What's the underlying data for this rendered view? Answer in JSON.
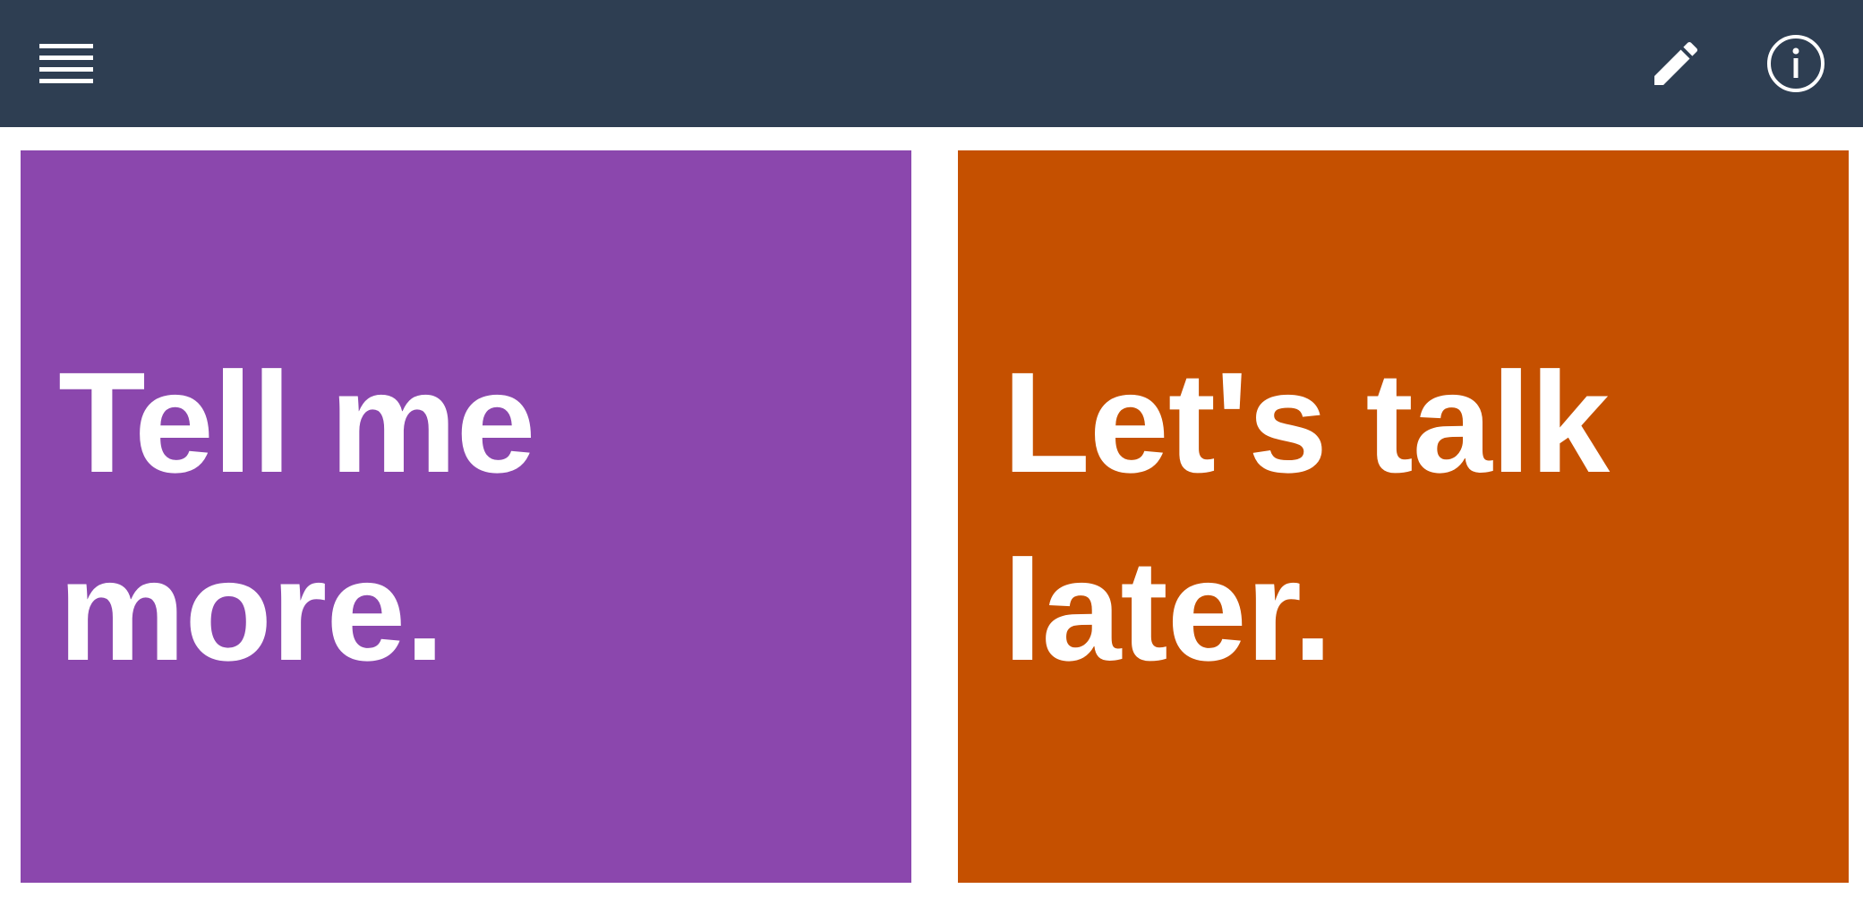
{
  "colors": {
    "topbar_bg": "#2e3e52",
    "icon_color": "#ffffff",
    "tile_text_color": "#ffffff"
  },
  "topbar": {
    "menu_icon": "hamburger-menu-icon",
    "edit_icon": "pencil-icon",
    "info_icon": "info-circle-icon"
  },
  "tiles": [
    {
      "label": "Tell me more.",
      "color": "#8b47ad"
    },
    {
      "label": "Let's talk later.",
      "color": "#c55000"
    }
  ]
}
